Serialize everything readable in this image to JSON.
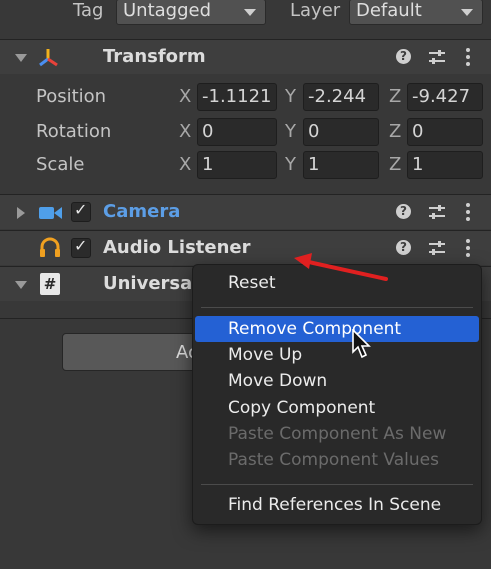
{
  "header": {
    "tag_label": "Tag",
    "tag_value": "Untagged",
    "layer_label": "Layer",
    "layer_value": "Default"
  },
  "transform": {
    "title": "Transform",
    "rows": [
      {
        "name": "Position",
        "x": "-1.1121",
        "y": "-2.244",
        "z": "-9.427"
      },
      {
        "name": "Rotation",
        "x": "0",
        "y": "0",
        "z": "0"
      },
      {
        "name": "Scale",
        "x": "1",
        "y": "1",
        "z": "1"
      }
    ],
    "axes": {
      "x": "X",
      "y": "Y",
      "z": "Z"
    }
  },
  "camera": {
    "title": "Camera",
    "enabled": true
  },
  "audio_listener": {
    "title": "Audio Listener",
    "enabled": true
  },
  "universal": {
    "title": "Universal"
  },
  "add_component": {
    "label": "Ac"
  },
  "context_menu": {
    "items": [
      {
        "label": "Reset",
        "enabled": true
      },
      {
        "label": "Remove Component",
        "enabled": true,
        "highlighted": true
      },
      {
        "label": "Move Up",
        "enabled": true
      },
      {
        "label": "Move Down",
        "enabled": true
      },
      {
        "label": "Copy Component",
        "enabled": true
      },
      {
        "label": "Paste Component As New",
        "enabled": false
      },
      {
        "label": "Paste Component Values",
        "enabled": false
      },
      {
        "label": "Find References In Scene",
        "enabled": true
      }
    ]
  },
  "colors": {
    "background": "#383838",
    "header_bg": "#3e3e3e",
    "camera_title": "#5c9ee6",
    "menu_bg": "#292929",
    "menu_highlight": "#2461d4",
    "annotation_arrow": "#e02020",
    "audio_icon": "#f0a020"
  },
  "icons": {
    "transform": "transform-axes-icon",
    "camera": "video-camera-icon",
    "audio": "headphones-icon",
    "script": "hash-script-icon",
    "help": "help-icon",
    "presets": "sliders-icon",
    "more": "kebab-menu-icon",
    "cursor": "mouse-pointer-icon"
  }
}
